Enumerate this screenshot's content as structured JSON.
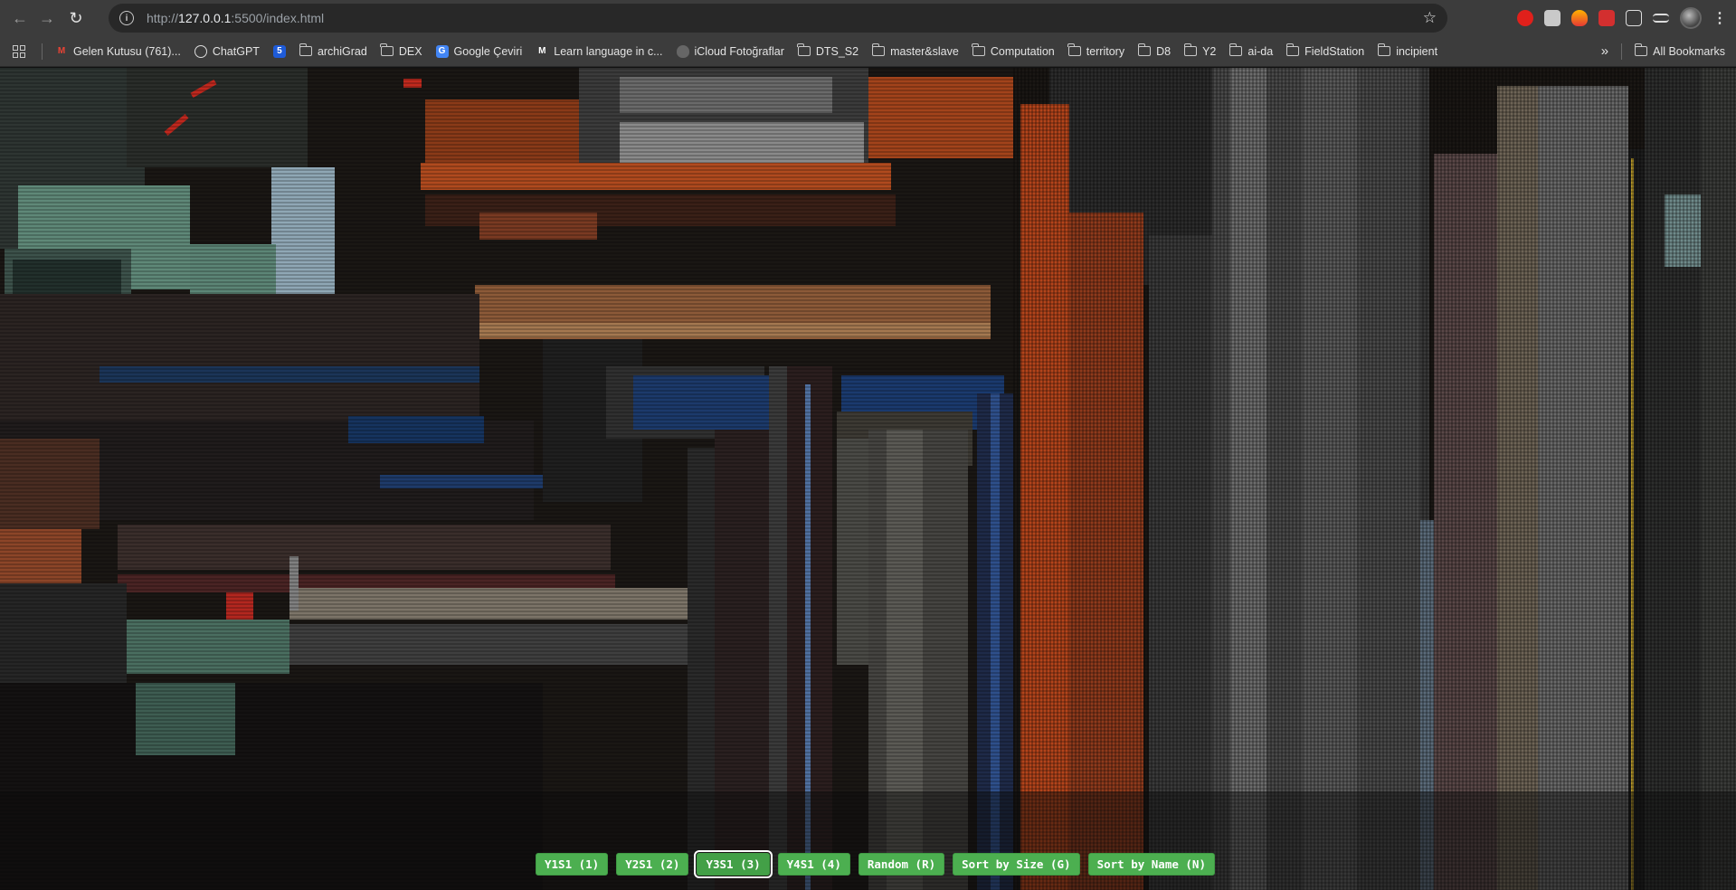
{
  "browser": {
    "url_prefix": "http://",
    "url_host": "127.0.0.1",
    "url_rest": ":5500/index.html",
    "icons": [
      "back-arrow-icon",
      "forward-arrow-icon",
      "reload-icon",
      "site-info-icon",
      "bookmark-star-icon"
    ]
  },
  "bookmarks": {
    "items": [
      {
        "label": "Gelen Kutusu (761)...",
        "icon": "gmail-icon"
      },
      {
        "label": "ChatGPT",
        "icon": "chatgpt-icon"
      },
      {
        "label": "",
        "icon": "five-icon"
      },
      {
        "label": "archiGrad",
        "icon": "folder-icon"
      },
      {
        "label": "DEX",
        "icon": "folder-icon"
      },
      {
        "label": "Google Çeviri",
        "icon": "translate-icon"
      },
      {
        "label": "Learn language in c...",
        "icon": "m-icon"
      },
      {
        "label": "iCloud Fotoğraflar",
        "icon": "apple-icon"
      },
      {
        "label": "DTS_S2",
        "icon": "folder-icon"
      },
      {
        "label": "master&slave",
        "icon": "folder-icon"
      },
      {
        "label": "Computation",
        "icon": "folder-icon"
      },
      {
        "label": "territory",
        "icon": "folder-icon"
      },
      {
        "label": "D8",
        "icon": "folder-icon"
      },
      {
        "label": "Y2",
        "icon": "folder-icon"
      },
      {
        "label": "ai-da",
        "icon": "folder-icon"
      },
      {
        "label": "FieldStation",
        "icon": "folder-icon"
      },
      {
        "label": "incipient",
        "icon": "folder-icon"
      }
    ],
    "overflow": "»",
    "all_bookmarks": "All Bookmarks"
  },
  "controls": {
    "buttons": [
      {
        "label": "Y1S1 (1)",
        "active": false
      },
      {
        "label": "Y2S1 (2)",
        "active": false
      },
      {
        "label": "Y3S1 (3)",
        "active": true
      },
      {
        "label": "Y4S1 (4)",
        "active": false
      },
      {
        "label": "Random (R)",
        "active": false
      },
      {
        "label": "Sort by Size (G)",
        "active": false
      },
      {
        "label": "Sort by Name (N)",
        "active": false
      }
    ],
    "accent_color": "#4caf50"
  },
  "colors": {
    "chrome_bg": "#3c3c3c",
    "omnibox_bg": "#282828",
    "page_bg": "#141414"
  }
}
